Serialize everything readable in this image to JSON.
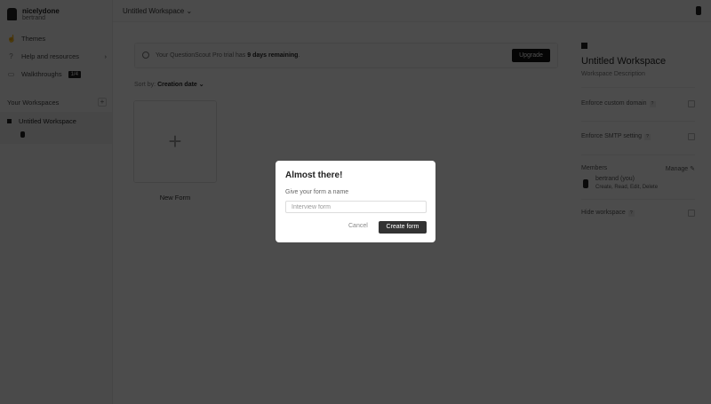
{
  "sidebar": {
    "user_name": "nicelydone",
    "user_sub": "bertrand",
    "items": [
      {
        "label": "Themes"
      },
      {
        "label": "Help and resources"
      },
      {
        "label": "Walkthroughs",
        "badge": "1/4"
      }
    ],
    "workspaces_heading": "Your Workspaces",
    "workspace_item": "Untitled Workspace"
  },
  "topbar": {
    "title": "Untitled Workspace ⌄"
  },
  "banner": {
    "text": "Your QuestionScout Pro trial has ",
    "highlight": "9 days remaining",
    "end": ".",
    "upgrade": "Upgrade"
  },
  "sort": {
    "label": "Sort by: ",
    "value": "Creation date ⌄"
  },
  "new_form": {
    "label": "New Form"
  },
  "right": {
    "title": "Untitled Workspace",
    "description": "Workspace Description",
    "custom_domain": "Enforce custom domain",
    "smtp": "Enforce SMTP setting",
    "members": "Members",
    "manage": "Manage",
    "member_name": "bertrand (you)",
    "member_perms": "Create, Read, Edit, Delete",
    "hide": "Hide workspace"
  },
  "modal": {
    "title": "Almost there!",
    "label": "Give your form a name",
    "placeholder": "Interview form",
    "cancel": "Cancel",
    "create": "Create form"
  }
}
